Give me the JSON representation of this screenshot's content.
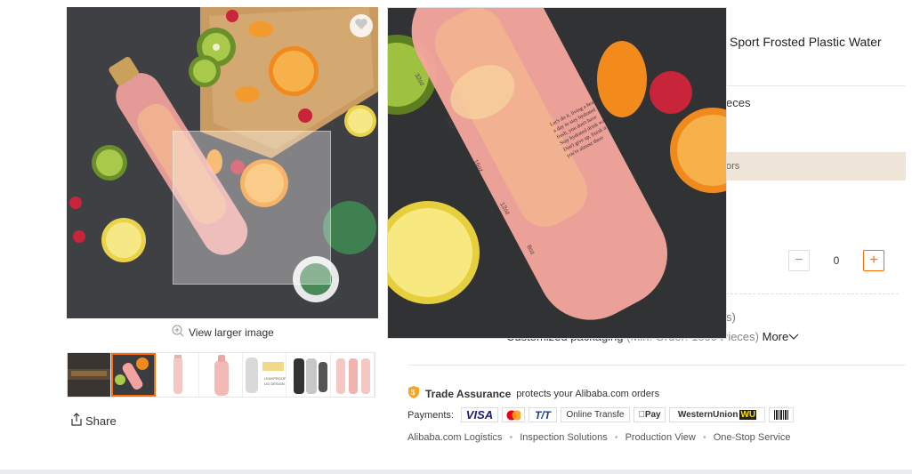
{
  "gallery": {
    "view_larger": "View larger image",
    "share": "Share",
    "thumbnails": [
      {
        "name": "thumb-video"
      },
      {
        "name": "thumb-fruit-bottle",
        "active": true
      },
      {
        "name": "thumb-pink-bottle"
      },
      {
        "name": "thumb-pink-bottle-2"
      },
      {
        "name": "thumb-leakproof"
      },
      {
        "name": "thumb-bottle-set"
      },
      {
        "name": "thumb-pink-set"
      }
    ],
    "thumb_texts": {
      "leakproof": "LEAKPROOF LID DESIGN"
    }
  },
  "product": {
    "title_fragment": "Sport Frosted Plastic Water",
    "pieces_fragment": "eces",
    "banner_fragment": "ors",
    "quantity": "0",
    "option_fragment": "s)",
    "custom_label": "Customized packaging",
    "custom_min": "(Min. Order: 1000 Pieces)",
    "more": "More"
  },
  "trade": {
    "name": "Trade Assurance",
    "text": "protects your Alibaba.com orders"
  },
  "payments": {
    "label": "Payments:",
    "methods": [
      "VISA",
      "",
      "T/T",
      "Online Transfe",
      "Pay",
      "WesternUnion",
      "WU",
      ""
    ]
  },
  "services": [
    "Alibaba.com Logistics",
    "Inspection Solutions",
    "Production View",
    "One-Stop Service"
  ],
  "zoom": {
    "marks": [
      "32oz",
      "24oz",
      "16oz",
      "12oz",
      "8oz"
    ]
  },
  "colors": {
    "accent": "#ff6a00",
    "banner": "#efe4d8",
    "trade_icon": "#f5a623"
  }
}
